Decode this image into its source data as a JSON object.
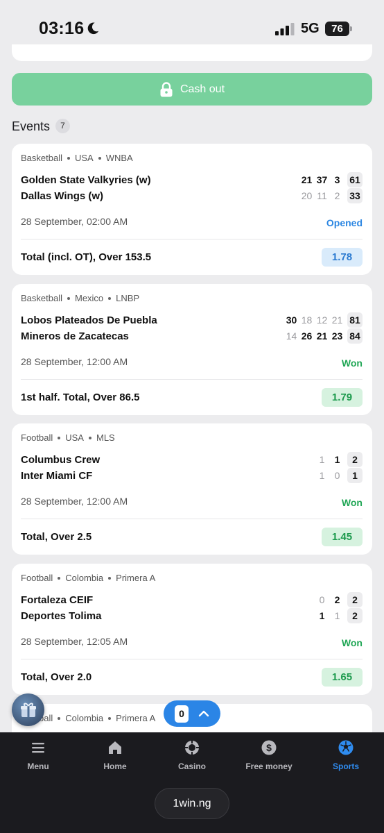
{
  "status_bar": {
    "time": "03:16",
    "network": "5G",
    "battery": "76"
  },
  "cashout": {
    "label": "Cash out"
  },
  "events": {
    "title": "Events",
    "count": "7"
  },
  "cards": [
    {
      "sport": "Basketball",
      "country": "USA",
      "league": "WNBA",
      "team1": "Golden State Valkyries (w)",
      "team2": "Dallas Wings (w)",
      "scores1": [
        "21",
        "37",
        "3"
      ],
      "total1": "61",
      "scores2": [
        "20",
        "11",
        "2"
      ],
      "total2": "33",
      "date": "28 September, 02:00 AM",
      "status": "Opened",
      "bet": "Total (incl. OT), Over 153.5",
      "odd": "1.78"
    },
    {
      "sport": "Basketball",
      "country": "Mexico",
      "league": "LNBP",
      "team1": "Lobos Plateados De Puebla",
      "team2": "Mineros de Zacatecas",
      "scores1": [
        "30",
        "18",
        "12",
        "21"
      ],
      "total1": "81",
      "scores2": [
        "14",
        "26",
        "21",
        "23"
      ],
      "total2": "84",
      "date": "28 September, 12:00 AM",
      "status": "Won",
      "bet": "1st half. Total, Over 86.5",
      "odd": "1.79"
    },
    {
      "sport": "Football",
      "country": "USA",
      "league": "MLS",
      "team1": "Columbus Crew",
      "team2": "Inter Miami CF",
      "scores1": [
        "1",
        "1"
      ],
      "total1": "2",
      "scores2": [
        "1",
        "0"
      ],
      "total2": "1",
      "date": "28 September, 12:00 AM",
      "status": "Won",
      "bet": "Total, Over 2.5",
      "odd": "1.45"
    },
    {
      "sport": "Football",
      "country": "Colombia",
      "league": "Primera A",
      "team1": "Fortaleza CEIF",
      "team2": "Deportes Tolima",
      "scores1": [
        "0",
        "2"
      ],
      "total1": "2",
      "scores2": [
        "1",
        "1"
      ],
      "total2": "2",
      "date": "28 September, 12:05 AM",
      "status": "Won",
      "bet": "Total, Over 2.0",
      "odd": "1.65"
    },
    {
      "sport": "Football",
      "country": "Colombia",
      "league": "Primera A"
    }
  ],
  "bet_slip": {
    "count": "0"
  },
  "nav": [
    {
      "label": "Menu",
      "icon": "menu-icon"
    },
    {
      "label": "Home",
      "icon": "home-icon"
    },
    {
      "label": "Casino",
      "icon": "casino-chip-icon"
    },
    {
      "label": "Free money",
      "icon": "dollar-coin-icon"
    },
    {
      "label": "Sports",
      "icon": "soccer-ball-icon"
    }
  ],
  "browser": {
    "url": "1win.ng"
  },
  "colors": {
    "accent": "#2f8cf0",
    "won": "#21a756",
    "opened": "#2b86e2",
    "cashout": "#78d19d",
    "nav_bg": "#1b1b1f"
  }
}
